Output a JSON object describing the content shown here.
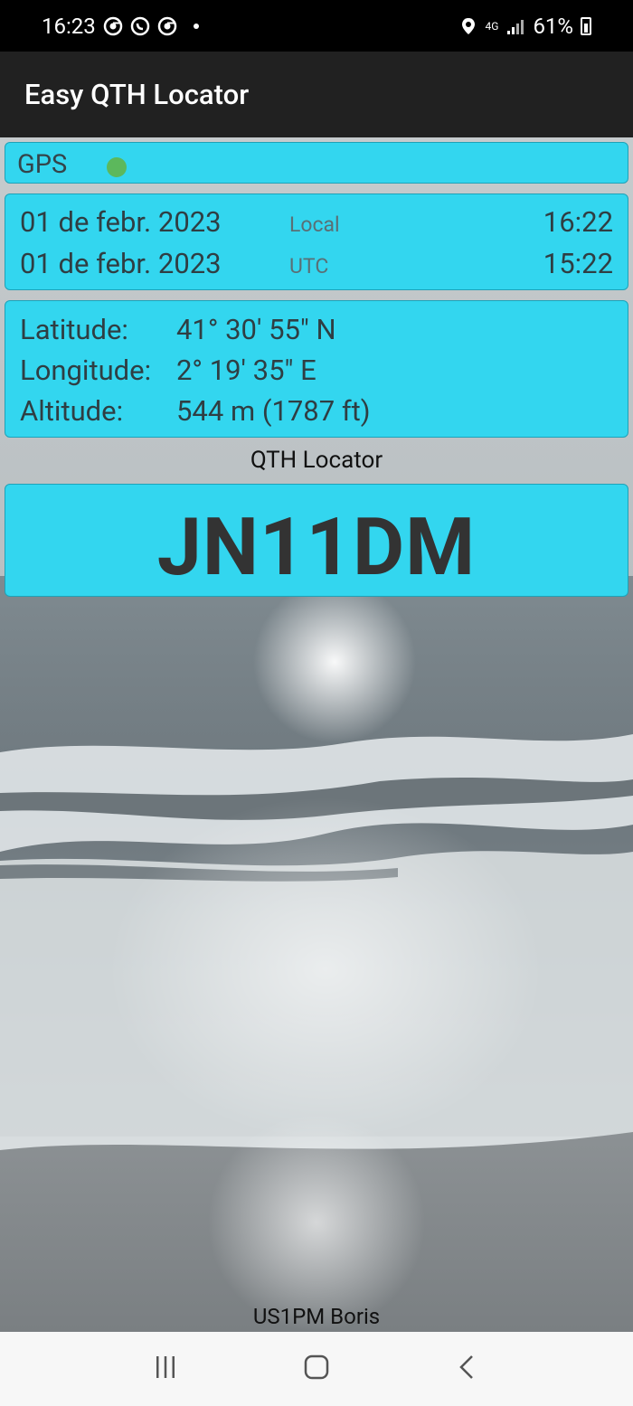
{
  "status_bar": {
    "time": "16:23",
    "network": "4G",
    "battery": "61%",
    "icons": [
      "chrome-icon",
      "whatsapp-icon",
      "chrome-icon",
      "notification-dot",
      "location-icon",
      "network-4g-icon",
      "signal-icon",
      "battery-icon"
    ]
  },
  "app_bar": {
    "title": "Easy QTH Locator"
  },
  "gps": {
    "label": "GPS",
    "status_color": "#5cb85c"
  },
  "time": {
    "local": {
      "date": "01 de febr. 2023",
      "zone": "Local",
      "time": "16:22"
    },
    "utc": {
      "date": "01 de febr. 2023",
      "zone": "UTC",
      "time": "15:22"
    }
  },
  "coordinates": {
    "latitude_label": "Latitude:",
    "latitude": "41° 30' 55\" N",
    "longitude_label": "Longitude:",
    "longitude": "2° 19' 35\" E",
    "altitude_label": "Altitude:",
    "altitude": "544 m (1787 ft)"
  },
  "locator": {
    "caption": "QTH Locator",
    "value": "JN11DM"
  },
  "footer": {
    "credit": "US1PM Boris"
  },
  "nav_bar": {
    "items": [
      "recent-apps-icon",
      "home-icon",
      "back-icon"
    ]
  },
  "colors": {
    "panel": "#33d6ef",
    "app_bar": "#212121",
    "status_bar": "#000000"
  }
}
